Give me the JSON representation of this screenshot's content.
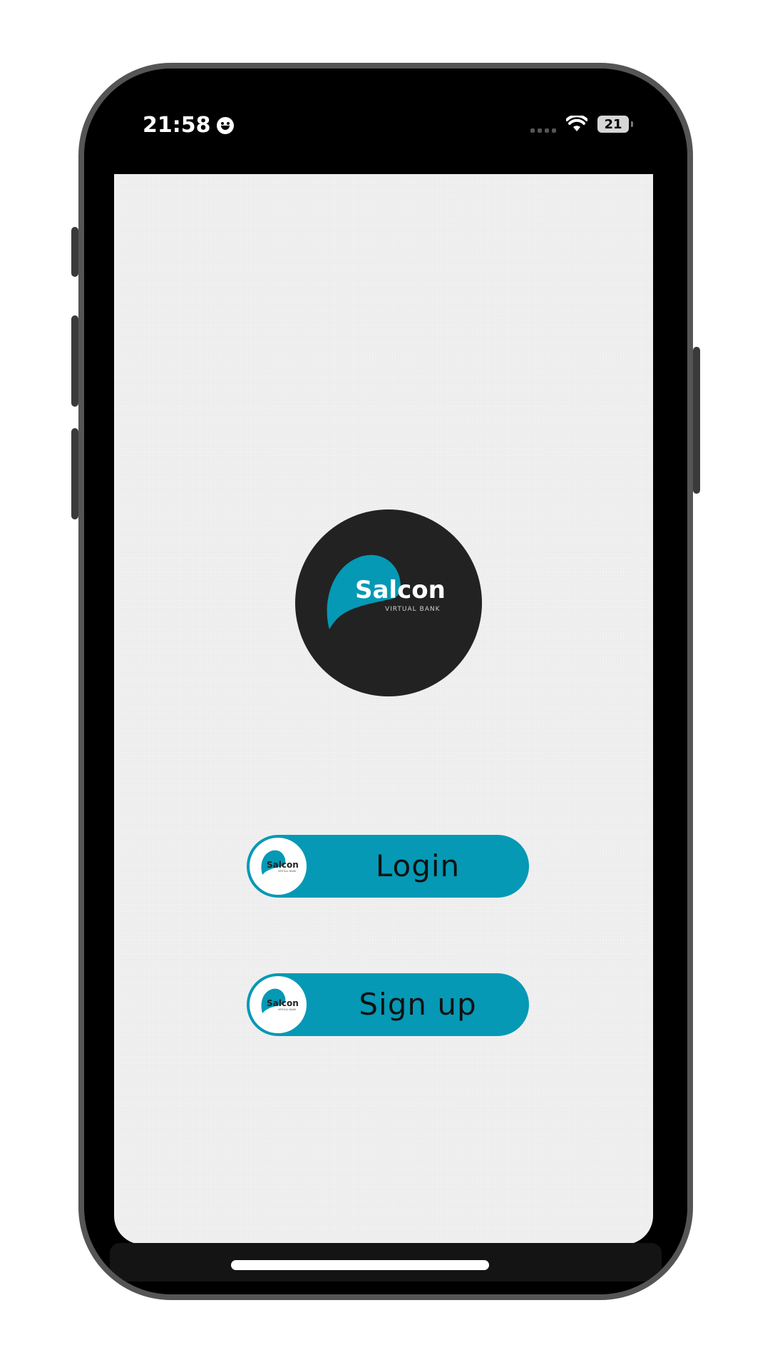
{
  "status_bar": {
    "time": "21:58",
    "emoji_icon": "smiley-face-icon",
    "wifi_icon": "wifi-icon",
    "battery_level": "21"
  },
  "logo": {
    "brand_name": "Salcon",
    "tagline": "VIRTUAL BANK",
    "accent_color": "#0599b5",
    "background_color": "#222222"
  },
  "buttons": {
    "login_label": "Login",
    "signup_label": "Sign up",
    "badge_brand": "Salcon",
    "badge_tagline": "VIRTUAL BANK",
    "button_color": "#0599b5"
  }
}
